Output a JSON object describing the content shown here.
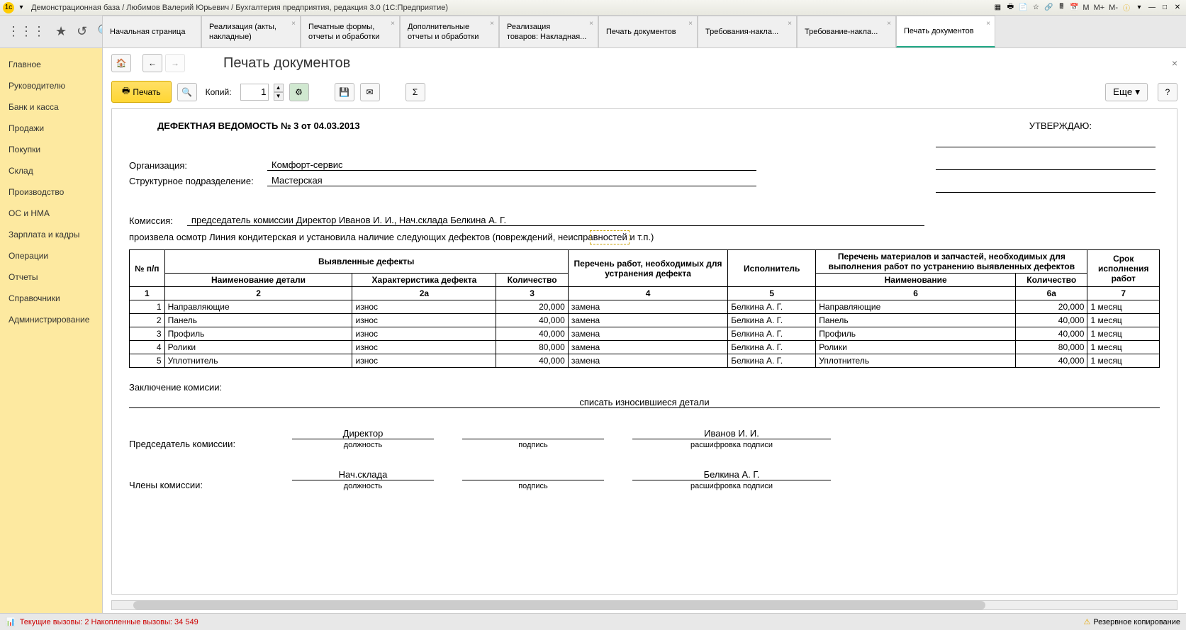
{
  "titlebar": {
    "text": "Демонстрационная база / Любимов Валерий Юрьевич / Бухгалтерия предприятия, редакция 3.0  (1С:Предприятие)"
  },
  "mem_buttons": [
    "M",
    "M+",
    "M-"
  ],
  "tabs": [
    {
      "line1": "Начальная страница",
      "line2": ""
    },
    {
      "line1": "Реализация (акты,",
      "line2": "накладные)"
    },
    {
      "line1": "Печатные формы,",
      "line2": "отчеты и обработки"
    },
    {
      "line1": "Дополнительные",
      "line2": "отчеты и обработки"
    },
    {
      "line1": "Реализация",
      "line2": "товаров: Накладная..."
    },
    {
      "line1": "Печать документов",
      "line2": ""
    },
    {
      "line1": "Требования-накла...",
      "line2": ""
    },
    {
      "line1": "Требование-накла...",
      "line2": ""
    },
    {
      "line1": "Печать документов",
      "line2": ""
    }
  ],
  "sidebar": [
    "Главное",
    "Руководителю",
    "Банк и касса",
    "Продажи",
    "Покупки",
    "Склад",
    "Производство",
    "ОС и НМА",
    "Зарплата и кадры",
    "Операции",
    "Отчеты",
    "Справочники",
    "Администрирование"
  ],
  "page_title": "Печать документов",
  "toolbar": {
    "print": "Печать",
    "copies_label": "Копий:",
    "copies_value": "1",
    "more": "Еще",
    "help": "?"
  },
  "doc": {
    "title": "ДЕФЕКТНАЯ ВЕДОМОСТЬ № 3 от 04.03.2013",
    "approve": "УТВЕРЖДАЮ:",
    "org_label": "Организация:",
    "org_value": "Комфорт-сервис",
    "dept_label": "Структурное подразделение:",
    "dept_value": "Мастерская",
    "commission_label": "Комиссия:",
    "commission_value": "председатель комиссии Директор Иванов И. И., Нач.склада Белкина А. Г.",
    "inspect_text": "произвела осмотр Линия кондитерская и установила наличие следующих дефектов (повреждений, неисправностей и т.п.)",
    "headers": {
      "num": "№ п/п",
      "defects": "Выявленные дефекты",
      "detail": "Наименование детали",
      "char": "Характеристика дефекта",
      "qty": "Количество",
      "works": "Перечень работ, необходимых для устранения дефекта",
      "executor": "Исполнитель",
      "materials": "Перечень материалов и запчастей, необходимых для выполнения работ по устранению выявленных дефектов",
      "mat_name": "Наименование",
      "mat_qty": "Количество",
      "deadline": "Срок исполнения работ",
      "c1": "1",
      "c2": "2",
      "c2a": "2а",
      "c3": "3",
      "c4": "4",
      "c5": "5",
      "c6": "6",
      "c6a": "6а",
      "c7": "7"
    },
    "rows": [
      {
        "n": "1",
        "detail": "Направляющие",
        "char": "износ",
        "qty": "20,000",
        "work": "замена",
        "exec": "Белкина А. Г.",
        "mat": "Направляющие",
        "mqty": "20,000",
        "term": "1 месяц"
      },
      {
        "n": "2",
        "detail": "Панель",
        "char": "износ",
        "qty": "40,000",
        "work": "замена",
        "exec": "Белкина А. Г.",
        "mat": "Панель",
        "mqty": "40,000",
        "term": "1 месяц"
      },
      {
        "n": "3",
        "detail": "Профиль",
        "char": "износ",
        "qty": "40,000",
        "work": "замена",
        "exec": "Белкина А. Г.",
        "mat": "Профиль",
        "mqty": "40,000",
        "term": "1 месяц"
      },
      {
        "n": "4",
        "detail": "Ролики",
        "char": "износ",
        "qty": "80,000",
        "work": "замена",
        "exec": "Белкина А. Г.",
        "mat": "Ролики",
        "mqty": "80,000",
        "term": "1 месяц"
      },
      {
        "n": "5",
        "detail": "Уплотнитель",
        "char": "износ",
        "qty": "40,000",
        "work": "замена",
        "exec": "Белкина А. Г.",
        "mat": "Уплотнитель",
        "mqty": "40,000",
        "term": "1 месяц"
      }
    ],
    "conclusion_label": "Заключение комисии:",
    "conclusion_value": "списать износившиеся детали",
    "chairman_label": "Председатель комиссии:",
    "chairman_pos": "Директор",
    "chairman_name": "Иванов И. И.",
    "members_label": "Члены комиссии:",
    "member_pos": "Нач.склада",
    "member_name": "Белкина А. Г.",
    "cap_pos": "должность",
    "cap_sign": "подпись",
    "cap_name": "расшифровка подписи"
  },
  "status": {
    "perf": "Текущие вызовы: 2  Накопленные вызовы: 34 549",
    "backup": "Резервное копирование"
  }
}
